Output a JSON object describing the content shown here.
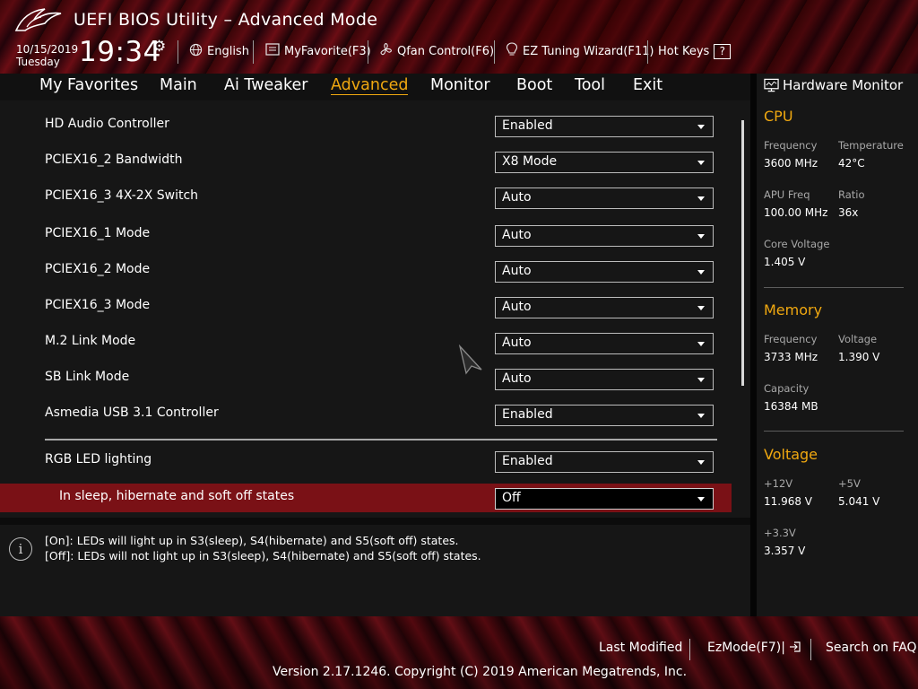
{
  "header": {
    "title": "UEFI BIOS Utility – Advanced Mode",
    "date": "10/15/2019",
    "day": "Tuesday",
    "time": "19:34",
    "language": "English",
    "myfavorite": "MyFavorite(F3)",
    "qfan": "Qfan Control(F6)",
    "ez_tuning": "EZ Tuning Wizard(F11)",
    "hot_keys": "Hot Keys",
    "hot_keys_badge": "?"
  },
  "menu": {
    "active": "Advanced",
    "items": [
      "My Favorites",
      "Main",
      "Ai Tweaker",
      "Advanced",
      "Monitor",
      "Boot",
      "Tool",
      "Exit"
    ]
  },
  "settings": [
    {
      "label": "HD Audio Controller",
      "value": "Enabled"
    },
    {
      "label": "PCIEX16_2 Bandwidth",
      "value": "X8 Mode"
    },
    {
      "label": "PCIEX16_3 4X-2X Switch",
      "value": "Auto"
    },
    {
      "label": "PCIEX16_1 Mode",
      "value": "Auto"
    },
    {
      "label": "PCIEX16_2 Mode",
      "value": "Auto"
    },
    {
      "label": "PCIEX16_3 Mode",
      "value": "Auto"
    },
    {
      "label": "M.2 Link Mode",
      "value": "Auto"
    },
    {
      "label": "SB Link Mode",
      "value": "Auto"
    },
    {
      "label": "Asmedia USB 3.1 Controller",
      "value": "Enabled"
    },
    {
      "label": "RGB LED lighting",
      "value": "Enabled"
    },
    {
      "label": "In sleep, hibernate and soft off states",
      "value": "Off",
      "selected": true
    }
  ],
  "info": {
    "line1": "[On]: LEDs will light up in S3(sleep), S4(hibernate) and S5(soft off) states.",
    "line2": "[Off]: LEDs will not light up in S3(sleep), S4(hibernate) and S5(soft off) states."
  },
  "monitor": {
    "title": "Hardware Monitor",
    "cpu": {
      "heading": "CPU",
      "frequency_label": "Frequency",
      "frequency": "3600 MHz",
      "temperature_label": "Temperature",
      "temperature": "42°C",
      "apu_label": "APU Freq",
      "apu": "100.00 MHz",
      "ratio_label": "Ratio",
      "ratio": "36x",
      "core_voltage_label": "Core Voltage",
      "core_voltage": "1.405 V"
    },
    "memory": {
      "heading": "Memory",
      "frequency_label": "Frequency",
      "frequency": "3733 MHz",
      "voltage_label": "Voltage",
      "voltage": "1.390 V",
      "capacity_label": "Capacity",
      "capacity": "16384 MB"
    },
    "voltage": {
      "heading": "Voltage",
      "v12_label": "+12V",
      "v12": "11.968 V",
      "v5_label": "+5V",
      "v5": "5.041 V",
      "v33_label": "+3.3V",
      "v33": "3.357 V"
    }
  },
  "footer": {
    "last_modified": "Last Modified",
    "ezmode": "EzMode(F7)|",
    "search_faq": "Search on FAQ",
    "copyright": "Version 2.17.1246. Copyright (C) 2019 American Megatrends, Inc."
  },
  "colors": {
    "accent": "#f0a810",
    "highlight_row": "#7a1116",
    "panel_bg": "#161616"
  }
}
